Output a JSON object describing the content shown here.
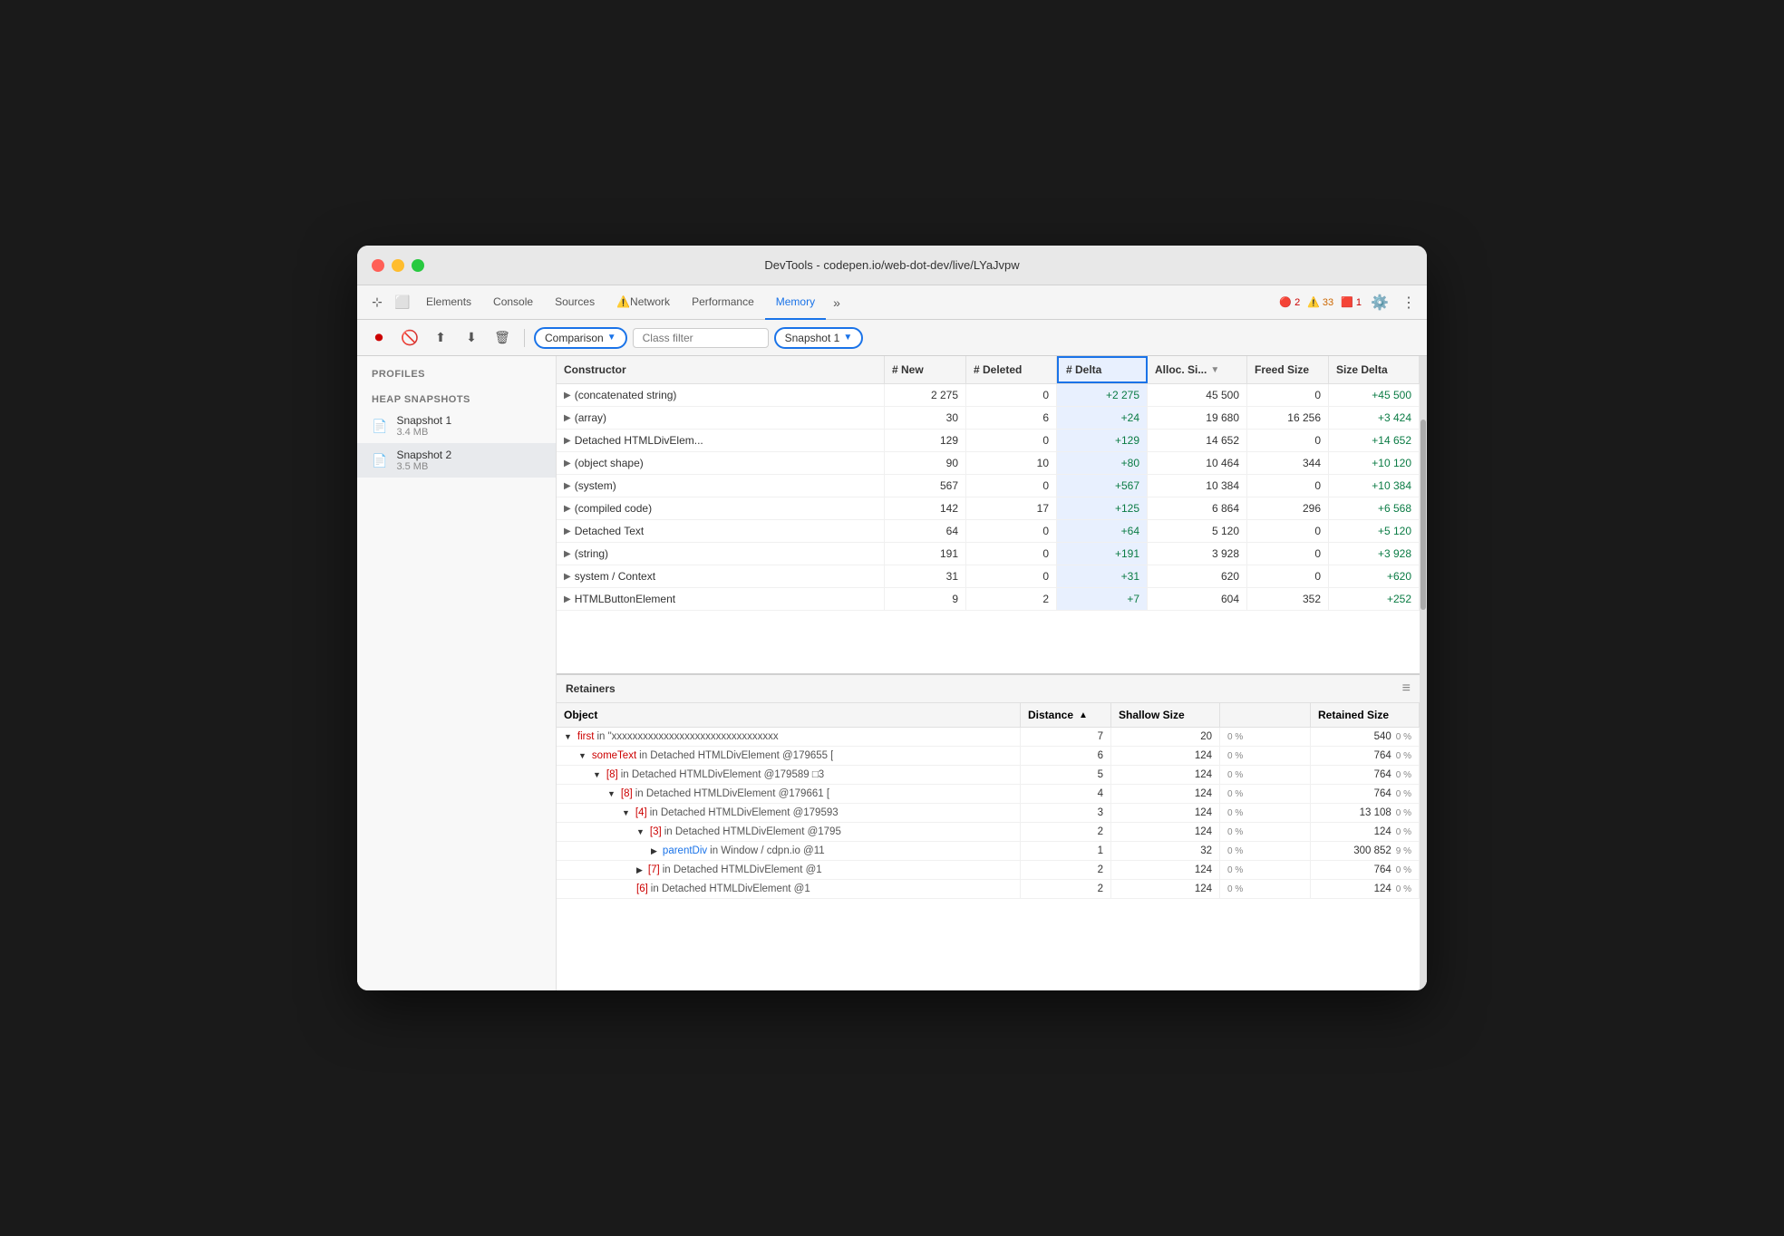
{
  "window": {
    "title": "DevTools - codepen.io/web-dot-dev/live/LYaJvpw"
  },
  "tabs": {
    "items": [
      {
        "label": "Elements",
        "active": false
      },
      {
        "label": "Console",
        "active": false
      },
      {
        "label": "Sources",
        "active": false
      },
      {
        "label": "Network",
        "active": false,
        "icon": "⚠️"
      },
      {
        "label": "Performance",
        "active": false
      },
      {
        "label": "Memory",
        "active": true
      }
    ],
    "more_label": "»",
    "error_count": "2",
    "warn_count": "33",
    "info_count": "1"
  },
  "toolbar": {
    "comparison_label": "Comparison",
    "class_filter_placeholder": "Class filter",
    "snapshot_label": "Snapshot 1"
  },
  "table": {
    "headers": [
      {
        "label": "Constructor",
        "key": "constructor"
      },
      {
        "label": "# New",
        "key": "new"
      },
      {
        "label": "# Deleted",
        "key": "deleted"
      },
      {
        "label": "# Delta",
        "key": "delta",
        "highlighted": true
      },
      {
        "label": "Alloc. Si...",
        "key": "alloc",
        "sort": true
      },
      {
        "label": "Freed Size",
        "key": "freed"
      },
      {
        "label": "Size Delta",
        "key": "sizedelta"
      }
    ],
    "rows": [
      {
        "constructor": "(concatenated string)",
        "new": "2 275",
        "deleted": "0",
        "delta": "+2 275",
        "alloc": "45 500",
        "freed": "0",
        "sizedelta": "+45 500"
      },
      {
        "constructor": "(array)",
        "new": "30",
        "deleted": "6",
        "delta": "+24",
        "alloc": "19 680",
        "freed": "16 256",
        "sizedelta": "+3 424"
      },
      {
        "constructor": "Detached HTMLDivElem...",
        "new": "129",
        "deleted": "0",
        "delta": "+129",
        "alloc": "14 652",
        "freed": "0",
        "sizedelta": "+14 652"
      },
      {
        "constructor": "(object shape)",
        "new": "90",
        "deleted": "10",
        "delta": "+80",
        "alloc": "10 464",
        "freed": "344",
        "sizedelta": "+10 120"
      },
      {
        "constructor": "(system)",
        "new": "567",
        "deleted": "0",
        "delta": "+567",
        "alloc": "10 384",
        "freed": "0",
        "sizedelta": "+10 384"
      },
      {
        "constructor": "(compiled code)",
        "new": "142",
        "deleted": "17",
        "delta": "+125",
        "alloc": "6 864",
        "freed": "296",
        "sizedelta": "+6 568"
      },
      {
        "constructor": "Detached Text",
        "new": "64",
        "deleted": "0",
        "delta": "+64",
        "alloc": "5 120",
        "freed": "0",
        "sizedelta": "+5 120"
      },
      {
        "constructor": "(string)",
        "new": "191",
        "deleted": "0",
        "delta": "+191",
        "alloc": "3 928",
        "freed": "0",
        "sizedelta": "+3 928"
      },
      {
        "constructor": "system / Context",
        "new": "31",
        "deleted": "0",
        "delta": "+31",
        "alloc": "620",
        "freed": "0",
        "sizedelta": "+620"
      },
      {
        "constructor": "HTMLButtonElement",
        "new": "9",
        "deleted": "2",
        "delta": "+7",
        "alloc": "604",
        "freed": "352",
        "sizedelta": "+252"
      }
    ]
  },
  "retainers": {
    "title": "Retainers",
    "headers": [
      "Object",
      "Distance",
      "Shallow Size",
      "",
      "Retained Size",
      ""
    ],
    "rows": [
      {
        "indent": 0,
        "object": "first",
        "suffix": " in \"xxxxxxxxxxxxxxxxxxxxxxxxxxxxxxxx",
        "distance": "7",
        "shallow": "20",
        "shallow_pct": "0 %",
        "retained": "540",
        "retained_pct": "0 %",
        "color": "red",
        "arrow": "▼"
      },
      {
        "indent": 1,
        "object": "someText",
        "suffix": " in Detached HTMLDivElement @179655 [",
        "distance": "6",
        "shallow": "124",
        "shallow_pct": "0 %",
        "retained": "764",
        "retained_pct": "0 %",
        "color": "red",
        "arrow": "▼"
      },
      {
        "indent": 2,
        "object": "[8]",
        "suffix": " in Detached HTMLDivElement @179589 □3",
        "distance": "5",
        "shallow": "124",
        "shallow_pct": "0 %",
        "retained": "764",
        "retained_pct": "0 %",
        "color": "red",
        "arrow": "▼"
      },
      {
        "indent": 3,
        "object": "[8]",
        "suffix": " in Detached HTMLDivElement @179661 [",
        "distance": "4",
        "shallow": "124",
        "shallow_pct": "0 %",
        "retained": "764",
        "retained_pct": "0 %",
        "color": "red",
        "arrow": "▼"
      },
      {
        "indent": 4,
        "object": "[4]",
        "suffix": " in Detached HTMLDivElement @179593",
        "distance": "3",
        "shallow": "124",
        "shallow_pct": "0 %",
        "retained": "13 108",
        "retained_pct": "0 %",
        "color": "red",
        "arrow": "▼"
      },
      {
        "indent": 5,
        "object": "[3]",
        "suffix": " in Detached HTMLDivElement @1795",
        "distance": "2",
        "shallow": "124",
        "shallow_pct": "0 %",
        "retained": "124",
        "retained_pct": "0 %",
        "color": "red",
        "arrow": "▼"
      },
      {
        "indent": 6,
        "object": "parentDiv",
        "suffix": " in Window / cdpn.io @11",
        "distance": "1",
        "shallow": "32",
        "shallow_pct": "0 %",
        "retained": "300 852",
        "retained_pct": "9 %",
        "color": "blue",
        "arrow": "▶"
      },
      {
        "indent": 5,
        "object": "[7]",
        "suffix": " in Detached HTMLDivElement @1",
        "distance": "2",
        "shallow": "124",
        "shallow_pct": "0 %",
        "retained": "764",
        "retained_pct": "0 %",
        "color": "red",
        "arrow": "▶"
      },
      {
        "indent": 5,
        "object": "[6]",
        "suffix": " in Detached HTMLDivElement @1",
        "distance": "2",
        "shallow": "124",
        "shallow_pct": "0 %",
        "retained": "124",
        "retained_pct": "0 %",
        "color": "red",
        "arrow": ""
      }
    ]
  },
  "sidebar": {
    "profiles_label": "Profiles",
    "heap_snapshots_label": "HEAP SNAPSHOTS",
    "snapshots": [
      {
        "name": "Snapshot 1",
        "size": "3.4 MB",
        "active": false
      },
      {
        "name": "Snapshot 2",
        "size": "3.5 MB",
        "active": true
      }
    ]
  }
}
